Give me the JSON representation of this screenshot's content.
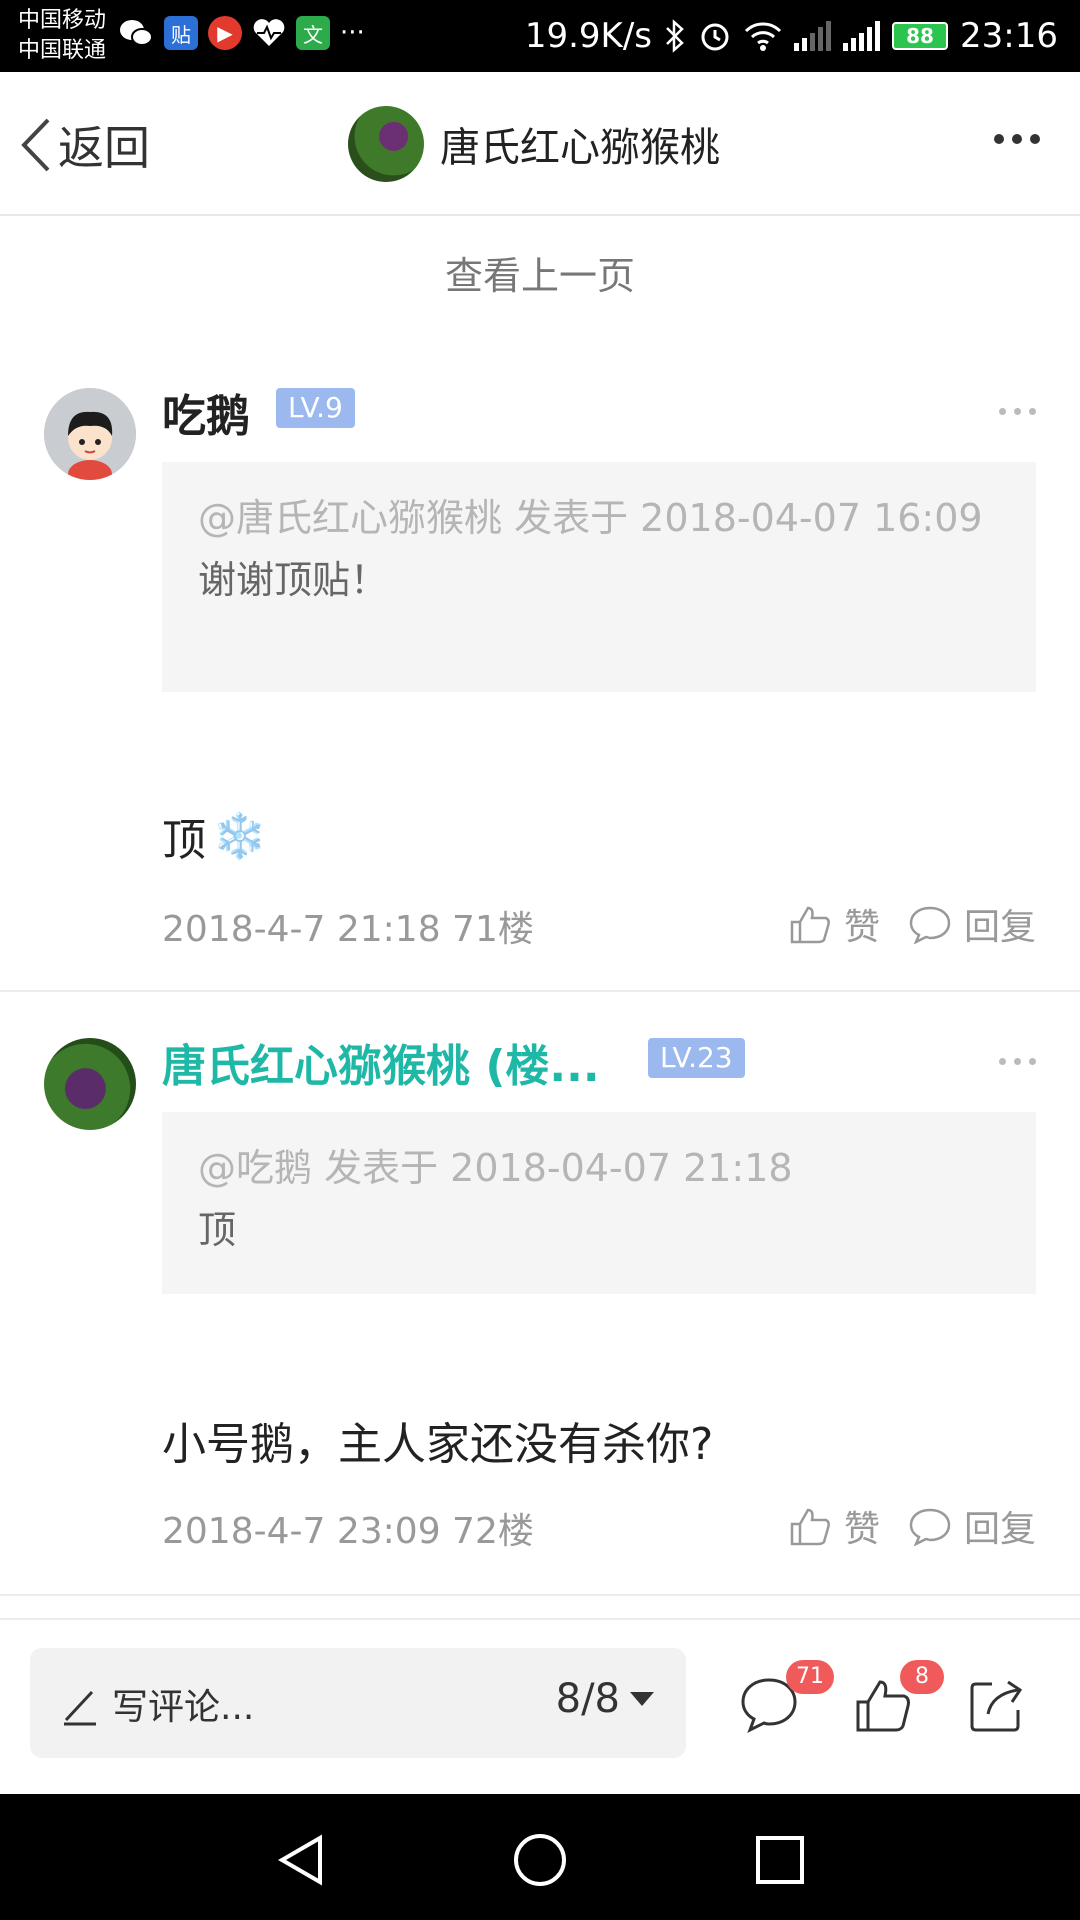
{
  "status_bar": {
    "carrier1": "中国移动",
    "carrier2": "中国联通",
    "app_icons": [
      "wechat-icon",
      "tieba-icon",
      "video-app-icon",
      "health-icon",
      "translate-icon"
    ],
    "tieba_label": "贴",
    "translate_label": "文",
    "more_notifications": "···",
    "net_speed": "19.9K/s",
    "battery": "88",
    "time": "23:16"
  },
  "nav": {
    "back_label": "返回",
    "title": "唐氏红心猕猴桃"
  },
  "prev_page_label": "查看上一页",
  "comments": [
    {
      "name": "吃鹅",
      "name_color": "#222222",
      "level": "LV.9",
      "quote_head": "@唐氏红心猕猴桃 发表于 2018-04-07 16:09",
      "quote_body": "谢谢顶贴！",
      "text": "顶",
      "emoji": "❄️",
      "meta": "2018-4-7 21:18  71楼",
      "like_label": "赞",
      "reply_label": "回复"
    },
    {
      "name": "唐氏红心猕猴桃 (楼...",
      "name_color": "#1fb8a7",
      "level": "LV.23",
      "quote_head": "@吃鹅 发表于 2018-04-07 21:18",
      "quote_body": "顶",
      "text": "小号鹅，主人家还没有杀你?",
      "meta": "2018-4-7 23:09  72楼",
      "like_label": "赞",
      "reply_label": "回复"
    }
  ],
  "bottom_bar": {
    "write_placeholder": "写评论...",
    "page_indicator": "8/8",
    "comment_count": "71",
    "like_count": "8"
  },
  "colors": {
    "accent": "#1fb8a7",
    "level_badge": "#9bb9ee",
    "badge": "#f05a5a"
  }
}
